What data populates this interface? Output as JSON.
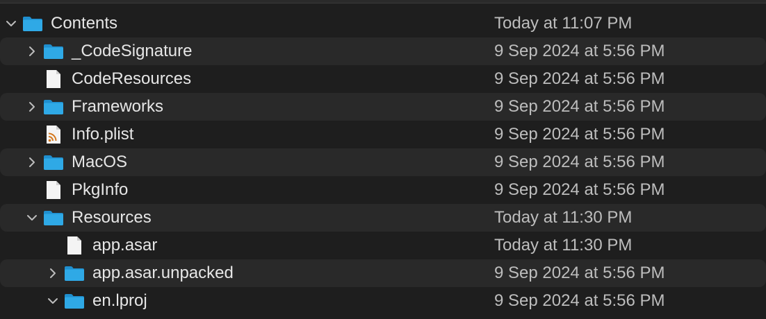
{
  "colors": {
    "background": "#1e1e1e",
    "alt_row": "#292929",
    "folder_blue": "#2fa9e6",
    "text": "#e6e6e6",
    "date_text": "#bdbdbd"
  },
  "rows": [
    {
      "name": "Contents",
      "date": "Today at 11:07 PM",
      "icon": "folder-icon",
      "disclosure": "expanded",
      "depth": 0
    },
    {
      "name": "_CodeSignature",
      "date": "9 Sep 2024 at 5:56 PM",
      "icon": "folder-icon",
      "disclosure": "collapsed",
      "depth": 1
    },
    {
      "name": "CodeResources",
      "date": "9 Sep 2024 at 5:56 PM",
      "icon": "document-icon",
      "disclosure": "none",
      "depth": 1
    },
    {
      "name": "Frameworks",
      "date": "9 Sep 2024 at 5:56 PM",
      "icon": "folder-icon",
      "disclosure": "collapsed",
      "depth": 1
    },
    {
      "name": "Info.plist",
      "date": "9 Sep 2024 at 5:56 PM",
      "icon": "plist-file-icon",
      "disclosure": "none",
      "depth": 1
    },
    {
      "name": "MacOS",
      "date": "9 Sep 2024 at 5:56 PM",
      "icon": "folder-icon",
      "disclosure": "collapsed",
      "depth": 1
    },
    {
      "name": "PkgInfo",
      "date": "9 Sep 2024 at 5:56 PM",
      "icon": "document-icon",
      "disclosure": "none",
      "depth": 1
    },
    {
      "name": "Resources",
      "date": "Today at 11:30 PM",
      "icon": "folder-icon",
      "disclosure": "expanded",
      "depth": 1
    },
    {
      "name": "app.asar",
      "date": "Today at 11:30 PM",
      "icon": "document-icon",
      "disclosure": "none",
      "depth": 2
    },
    {
      "name": "app.asar.unpacked",
      "date": "9 Sep 2024 at 5:56 PM",
      "icon": "folder-icon",
      "disclosure": "collapsed",
      "depth": 2
    },
    {
      "name": "en.lproj",
      "date": "9 Sep 2024 at 5:56 PM",
      "icon": "folder-icon",
      "disclosure": "expanded",
      "depth": 2
    }
  ]
}
